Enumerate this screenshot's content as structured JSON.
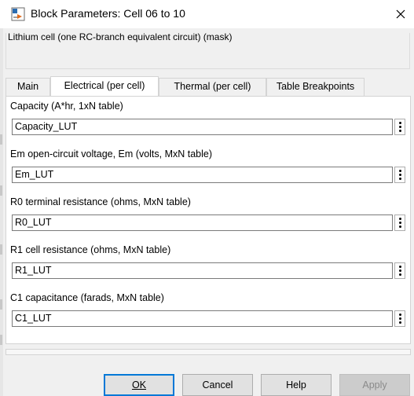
{
  "window": {
    "title": "Block Parameters: Cell 06 to 10",
    "app_icon": "simulink-block-icon",
    "close_icon": "close-icon"
  },
  "mask": {
    "description": "Lithium cell (one RC-branch equivalent circuit) (mask)"
  },
  "tabs": [
    {
      "label": "Main",
      "active": false
    },
    {
      "label": "Electrical (per cell)",
      "active": true
    },
    {
      "label": "Thermal (per cell)",
      "active": false
    },
    {
      "label": "Table Breakpoints",
      "active": false
    }
  ],
  "fields": [
    {
      "label": "Capacity (A*hr, 1xN table)",
      "value": "Capacity_LUT"
    },
    {
      "label": "Em open-circuit voltage, Em (volts, MxN table)",
      "value": "Em_LUT"
    },
    {
      "label": "R0 terminal resistance (ohms, MxN table)",
      "value": "R0_LUT"
    },
    {
      "label": "R1 cell resistance (ohms, MxN table)",
      "value": "R1_LUT"
    },
    {
      "label": "C1 capacitance (farads, MxN table)",
      "value": "C1_LUT"
    }
  ],
  "buttons": {
    "ok": "OK",
    "cancel": "Cancel",
    "help": "Help",
    "apply": "Apply"
  },
  "colors": {
    "default_button_border": "#0078d7",
    "dialog_background": "#f0f0f0"
  }
}
